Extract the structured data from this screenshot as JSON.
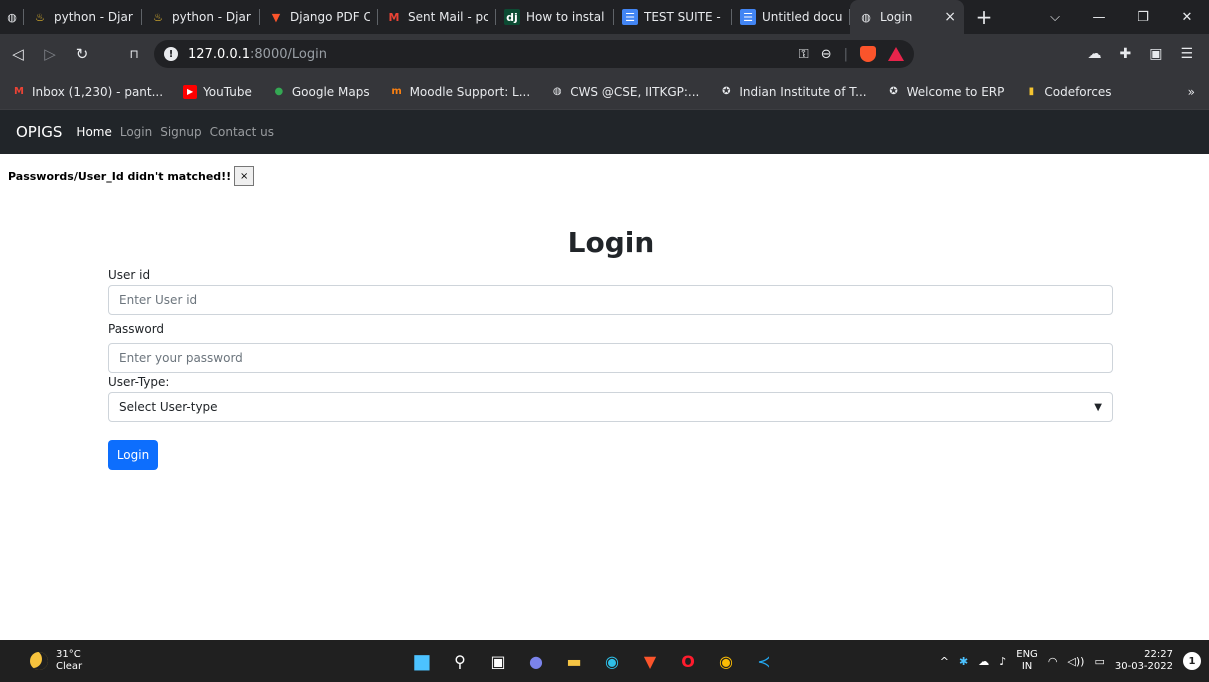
{
  "browser": {
    "tabs": [
      {
        "title": "python - Djar",
        "icon": "python-icon",
        "color": "#e8eaed"
      },
      {
        "title": "python - Djar",
        "icon": "python-icon",
        "color": "#e8eaed"
      },
      {
        "title": "Django PDF C",
        "icon": "brave-icon",
        "color": "#fb542b"
      },
      {
        "title": "Sent Mail - pc",
        "icon": "gmail-icon",
        "color": "#ea4335"
      },
      {
        "title": "How to instal",
        "icon": "django-icon",
        "color": "#0c4b33"
      },
      {
        "title": "TEST SUITE -",
        "icon": "docs-icon",
        "color": "#4285f4"
      },
      {
        "title": "Untitled docu",
        "icon": "docs-icon",
        "color": "#4285f4"
      },
      {
        "title": "Login",
        "icon": "globe-icon",
        "color": "#e8eaed",
        "active": true
      }
    ],
    "tab_close": "×",
    "new_tab": "+",
    "url_host": "127.0.0.1",
    "url_path": ":8000/Login",
    "bookmarks": [
      {
        "label": "Inbox (1,230) - pant...",
        "icon": "gmail-icon",
        "color": "#ea4335",
        "glyph": "M"
      },
      {
        "label": "YouTube",
        "icon": "youtube-icon",
        "color": "#ff0000",
        "glyph": "▶"
      },
      {
        "label": "Google Maps",
        "icon": "maps-icon",
        "color": "#34a853",
        "glyph": "●"
      },
      {
        "label": "Moodle Support: L...",
        "icon": "moodle-icon",
        "color": "#f98012",
        "glyph": "m"
      },
      {
        "label": "CWS @CSE, IITKGP:...",
        "icon": "globe-icon",
        "color": "#e8eaed",
        "glyph": "◍"
      },
      {
        "label": "Indian Institute of T...",
        "icon": "iit-logo-icon",
        "color": "#e8eaed",
        "glyph": "✪"
      },
      {
        "label": "Welcome to ERP",
        "icon": "iit-logo-icon",
        "color": "#e8eaed",
        "glyph": "✪"
      },
      {
        "label": "Codeforces",
        "icon": "codeforces-icon",
        "color": "#f4c430",
        "glyph": "▮"
      }
    ],
    "bookmarks_more": "»"
  },
  "site": {
    "brand": "OPIGS",
    "nav": [
      "Home",
      "Login",
      "Signup",
      "Contact us"
    ],
    "alert": "Passwords/User_Id didn't matched!!",
    "alert_close": "×",
    "title": "Login",
    "userid_label": "User id",
    "userid_placeholder": "Enter User id",
    "password_label": "Password",
    "password_placeholder": "Enter your password",
    "usertype_label": "User-Type:",
    "usertype_selected": "Select User-type",
    "submit_label": "Login"
  },
  "taskbar": {
    "temperature": "31°C",
    "condition": "Clear",
    "lang_top": "ENG",
    "lang_bottom": "IN",
    "time": "22:27",
    "date": "30-03-2022",
    "notifications": "1"
  }
}
